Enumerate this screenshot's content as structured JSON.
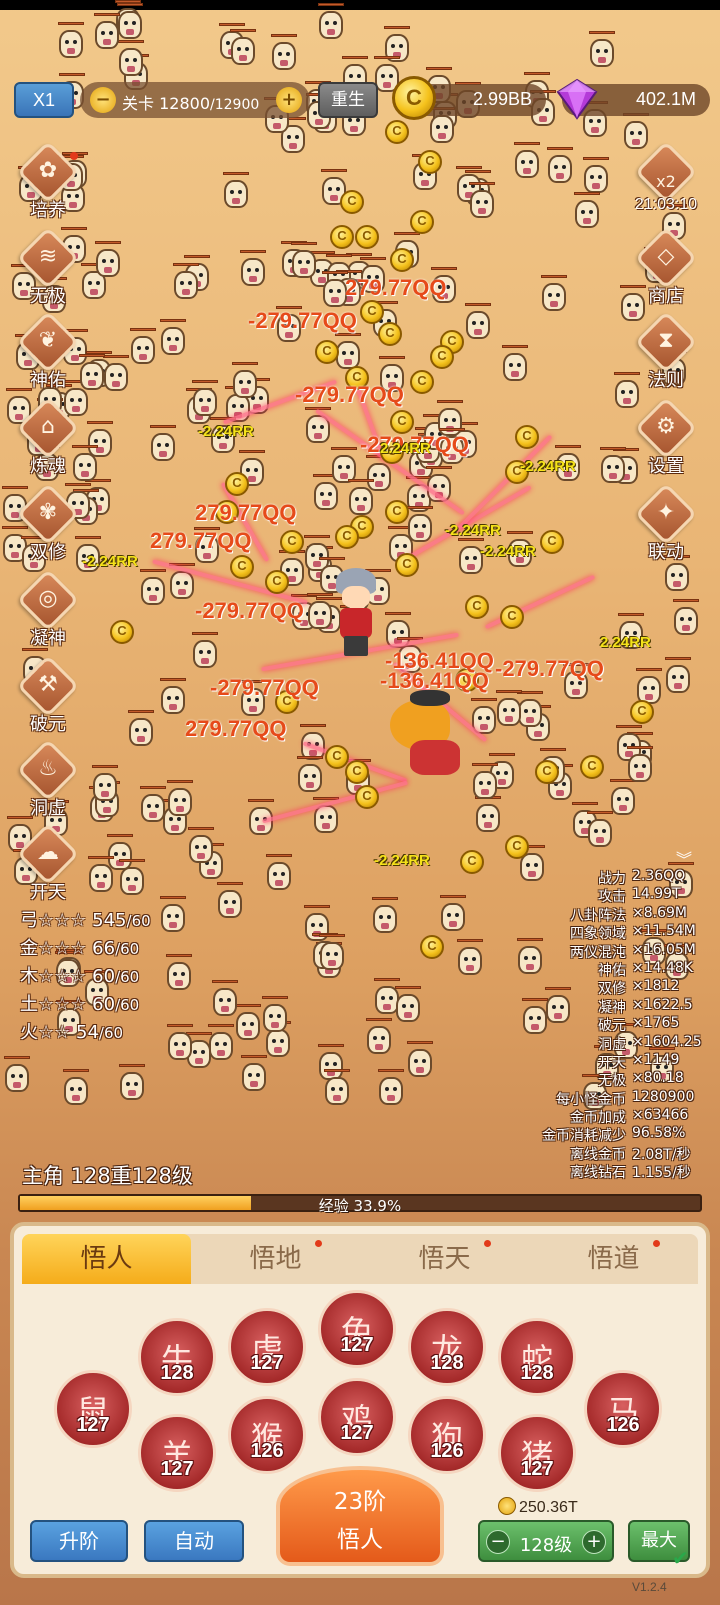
{
  "topbar": {
    "speed_label": "X1",
    "level_label": "关卡",
    "level_current": "12800",
    "level_max": "/12900",
    "rebirth_label": "重生",
    "gold_value": "2.99BB",
    "gem_value": "402.1M"
  },
  "left_menu": [
    {
      "label": "培养",
      "icon": "cultivate-icon",
      "glyph": "✿",
      "badge": true
    },
    {
      "label": "无极",
      "icon": "layers-icon",
      "glyph": "≋",
      "badge": false
    },
    {
      "label": "神佑",
      "icon": "wings-icon",
      "glyph": "❦",
      "badge": false
    },
    {
      "label": "炼魂",
      "icon": "house-icon",
      "glyph": "⌂",
      "badge": false
    },
    {
      "label": "双修",
      "icon": "lotus-icon",
      "glyph": "✾",
      "badge": false
    },
    {
      "label": "凝神",
      "icon": "orb-icon",
      "glyph": "◎",
      "badge": false
    },
    {
      "label": "破元",
      "icon": "axe-icon",
      "glyph": "⚒",
      "badge": false
    },
    {
      "label": "洞虚",
      "icon": "flame-icon",
      "glyph": "♨",
      "badge": false
    },
    {
      "label": "开天",
      "icon": "cloud-icon",
      "glyph": "☁",
      "badge": false
    }
  ],
  "right_menu": {
    "bonus_label": "x2",
    "timer": "21:03:10",
    "items": [
      {
        "label": "商店",
        "icon": "diamond-icon",
        "glyph": "◇"
      },
      {
        "label": "法则",
        "icon": "hourglass-icon",
        "glyph": "⧗"
      },
      {
        "label": "设置",
        "icon": "gear-icon",
        "glyph": "⚙"
      },
      {
        "label": "联动",
        "icon": "link-icon",
        "glyph": "✦"
      }
    ]
  },
  "damage_texts": {
    "big": [
      "279.77QQ",
      "-279.77QQ",
      "-279.77QQ",
      "-279.77QQ",
      "279.77QQ",
      "279.77QQ",
      "-279.77QQ",
      "-279.77QQ",
      "-136.41QQ",
      "-136.41QQ",
      "-279.77QQ",
      "279.77QQ"
    ],
    "small": [
      "-2.24RR",
      "-2.24RR",
      "-2.24RR",
      "2.24RR",
      "-2.24RR",
      "-2.24RR",
      "2.24RR",
      "-2.24RR"
    ]
  },
  "elements": [
    {
      "name": "弓",
      "stars": "☆☆☆",
      "value": "545",
      "max": "/60"
    },
    {
      "name": "金",
      "stars": "☆☆☆",
      "value": "66",
      "max": "/60"
    },
    {
      "name": "木",
      "stars": "☆☆☆",
      "value": "60",
      "max": "/60"
    },
    {
      "name": "土",
      "stars": "☆☆☆",
      "value": "60",
      "max": "/60"
    },
    {
      "name": "火",
      "stars": "☆☆",
      "value": "54",
      "max": "/60"
    }
  ],
  "stats": [
    {
      "k": "战力",
      "v": "2.36QQ"
    },
    {
      "k": "攻击",
      "v": "14.99T"
    },
    {
      "k": "八卦阵法",
      "v": "×8.69M"
    },
    {
      "k": "四象领域",
      "v": "×11.54M"
    },
    {
      "k": "两仪混沌",
      "v": "×16.05M"
    },
    {
      "k": "神佑",
      "v": "×14.48K"
    },
    {
      "k": "双修",
      "v": "×1812"
    },
    {
      "k": "凝神",
      "v": "×1622.5"
    },
    {
      "k": "破元",
      "v": "×1765"
    },
    {
      "k": "洞虚",
      "v": "×1604.25"
    },
    {
      "k": "开天",
      "v": "×1149"
    },
    {
      "k": "无极",
      "v": "×80.18"
    },
    {
      "k": "每小怪金币",
      "v": "1280900"
    },
    {
      "k": "金币加成",
      "v": "×63466"
    },
    {
      "k": "金币消耗减少",
      "v": "96.58%"
    },
    {
      "k": "离线金币",
      "v": "2.08T/秒"
    },
    {
      "k": "离线钻石",
      "v": "1.155/秒"
    }
  ],
  "hero": {
    "level_text": "主角 128重128级",
    "exp_label": "经验 33.9%",
    "exp_percent": 33.9
  },
  "tabs": [
    {
      "label": "悟人",
      "active": true,
      "badge": false
    },
    {
      "label": "悟地",
      "active": false,
      "badge": true
    },
    {
      "label": "悟天",
      "active": false,
      "badge": true
    },
    {
      "label": "悟道",
      "active": false,
      "badge": true
    }
  ],
  "zodiac": [
    {
      "name": "rat",
      "glyph": "鼠",
      "level": "127"
    },
    {
      "name": "ox",
      "glyph": "牛",
      "level": "128"
    },
    {
      "name": "tiger",
      "glyph": "虎",
      "level": "127"
    },
    {
      "name": "rabbit",
      "glyph": "兔",
      "level": "127"
    },
    {
      "name": "dragon",
      "glyph": "龙",
      "level": "128"
    },
    {
      "name": "snake",
      "glyph": "蛇",
      "level": "128"
    },
    {
      "name": "horse",
      "glyph": "马",
      "level": "126"
    },
    {
      "name": "goat",
      "glyph": "羊",
      "level": "127"
    },
    {
      "name": "monkey",
      "glyph": "猴",
      "level": "126"
    },
    {
      "name": "rooster",
      "glyph": "鸡",
      "level": "127"
    },
    {
      "name": "dog",
      "glyph": "狗",
      "level": "126"
    },
    {
      "name": "pig",
      "glyph": "猪",
      "level": "127"
    }
  ],
  "bottom": {
    "rank_line1": "23阶",
    "rank_line2": "悟人",
    "upgrade_label": "升阶",
    "auto_label": "自动",
    "cost": "250.36T",
    "level_value": "128级",
    "max_label": "最大",
    "version": "V1.2.4"
  },
  "colors": {
    "accent_orange": "#f5ac1a",
    "damage_red": "#e64a1a",
    "damage_yellow": "#f5e21a",
    "zodiac_red": "#a52a2a"
  }
}
